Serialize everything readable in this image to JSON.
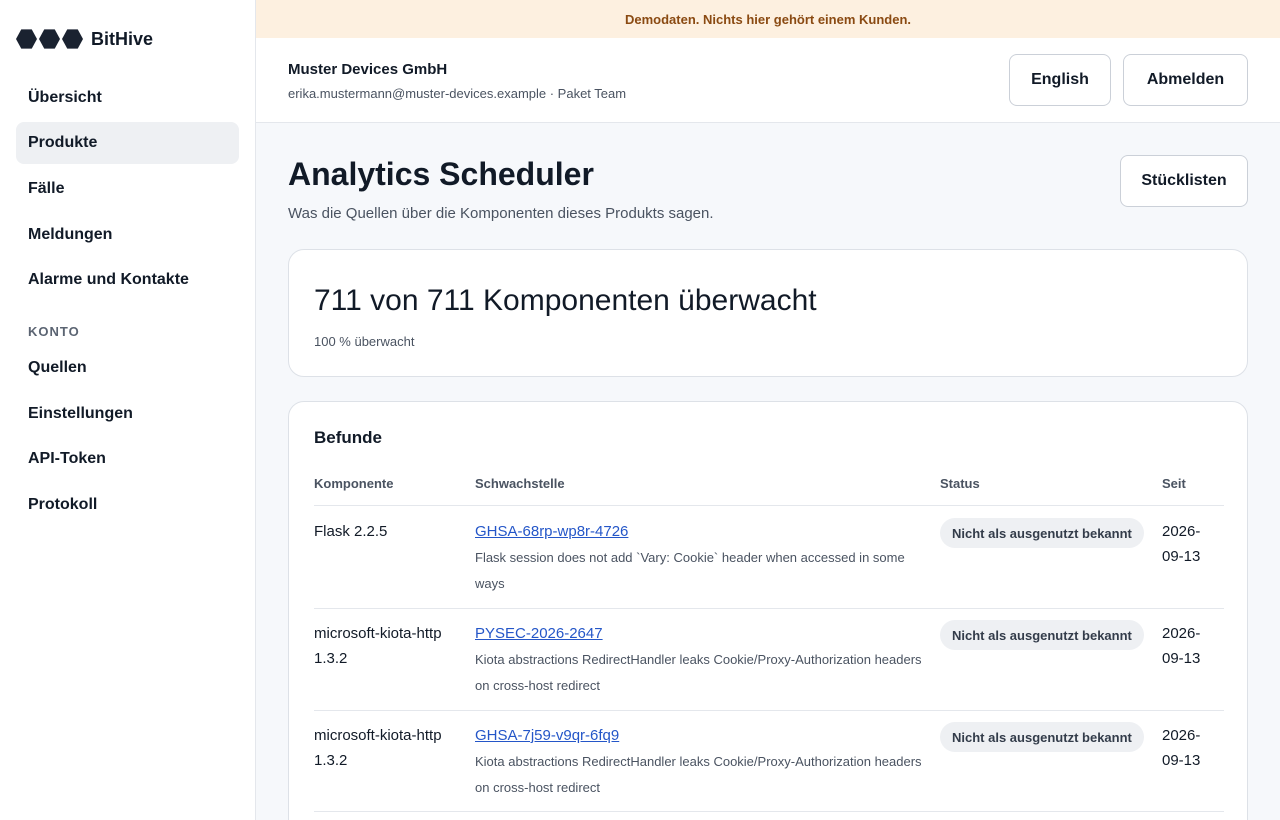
{
  "brand": {
    "name": "BitHive"
  },
  "sidebar": {
    "items": [
      {
        "label": "Übersicht"
      },
      {
        "label": "Produkte",
        "active": true
      },
      {
        "label": "Fälle"
      },
      {
        "label": "Meldungen"
      },
      {
        "label": "Alarme und Kontakte"
      }
    ],
    "section_label": "KONTO",
    "account_items": [
      {
        "label": "Quellen"
      },
      {
        "label": "Einstellungen"
      },
      {
        "label": "API-Token"
      },
      {
        "label": "Protokoll"
      }
    ]
  },
  "banner": {
    "text": "Demodaten. Nichts hier gehört einem Kunden."
  },
  "header": {
    "org_name": "Muster Devices GmbH",
    "org_sub": "erika.mustermann@muster-devices.example · Paket Team",
    "language_button": "English",
    "logout_button": "Abmelden"
  },
  "page": {
    "title": "Analytics Scheduler",
    "subtitle": "Was die Quellen über die Komponenten dieses Produkts sagen.",
    "sbom_button": "Stücklisten"
  },
  "monitoring": {
    "headline": "711 von 711 Komponenten überwacht",
    "percent_text": "100 % überwacht",
    "monitored": 711,
    "total": 711
  },
  "findings": {
    "title": "Befunde",
    "columns": [
      "Komponente",
      "Schwachstelle",
      "Status",
      "Seit"
    ],
    "rows": [
      {
        "component": "Flask 2.2.5",
        "vuln_id": "GHSA-68rp-wp8r-4726",
        "vuln_desc": "Flask session does not add `Vary: Cookie` header when accessed in some ways",
        "status": "Nicht als ausgenutzt bekannt",
        "since": "2026-09-13"
      },
      {
        "component": "microsoft-kiota-http 1.3.2",
        "vuln_id": "PYSEC-2026-2647",
        "vuln_desc": "Kiota abstractions RedirectHandler leaks Cookie/Proxy-Authorization headers on cross-host redirect",
        "status": "Nicht als ausgenutzt bekannt",
        "since": "2026-09-13"
      },
      {
        "component": "microsoft-kiota-http 1.3.2",
        "vuln_id": "GHSA-7j59-v9qr-6fq9",
        "vuln_desc": "Kiota abstractions RedirectHandler leaks Cookie/Proxy-Authorization headers on cross-host redirect",
        "status": "Nicht als ausgenutzt bekannt",
        "since": "2026-09-13"
      }
    ]
  },
  "colors": {
    "banner_bg": "#fdf0e0",
    "banner_text": "#8a4a12",
    "link": "#2456c8",
    "active_nav_bg": "#eef0f3"
  }
}
